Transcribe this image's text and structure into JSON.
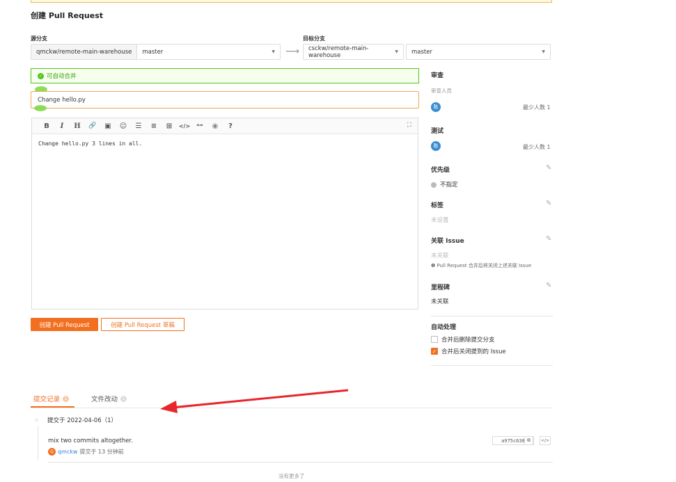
{
  "page": {
    "title": "创建 Pull Request"
  },
  "source": {
    "label": "源分支",
    "repo": "qmckw/remote-main-warehouse",
    "branch": "master"
  },
  "target": {
    "label": "目标分支",
    "repo": "csckw/remote-main-warehouse",
    "branch": "master"
  },
  "merge_status": "可自动合并",
  "pr": {
    "title": "Change hello.py",
    "body": "Change hello.py 3 lines in all."
  },
  "toolbar_icons": [
    "bold-icon",
    "italic-icon",
    "heading-icon",
    "link-icon",
    "image-icon",
    "emoji-icon",
    "unordered-list-icon",
    "ordered-list-icon",
    "table-icon",
    "code-icon",
    "quote-icon",
    "preview-icon",
    "help-icon"
  ],
  "toolbar_glyphs": {
    "bold": "B",
    "italic": "I",
    "heading": "H",
    "link": "🔗",
    "image": "▣",
    "emoji": "☺",
    "ul": "☰",
    "ol": "≡",
    "table": "⊞",
    "code": "</>",
    "quote": "❝❝",
    "preview": "◉",
    "help": "?"
  },
  "buttons": {
    "create": "创建 Pull Request",
    "create_draft": "创建 Pull Request 草稿"
  },
  "sidebar": {
    "review": {
      "title": "审查",
      "reviewers_label": "审查人员",
      "reviewer_avatar": "陈",
      "min_count": "最少人数 1"
    },
    "test": {
      "title": "测试",
      "tester_avatar": "陈",
      "min_count": "最少人数 1"
    },
    "priority": {
      "title": "优先级",
      "value": "不指定"
    },
    "labels": {
      "title": "标签",
      "value": "未设置"
    },
    "issue": {
      "title": "关联 Issue",
      "value": "未关联",
      "note": "Pull Request 合并后将关闭上述关联 Issue"
    },
    "milestone": {
      "title": "里程碑",
      "value": "未关联"
    },
    "auto": {
      "title": "自动处理",
      "opt_delete_branch": "合并后删除提交分支",
      "opt_delete_checked": false,
      "opt_close_issue": "合并后关闭提到的 Issue",
      "opt_close_checked": true
    }
  },
  "tabs": {
    "commits": "提交记录",
    "commits_badge": "1",
    "files": "文件改动",
    "files_badge": "1"
  },
  "commits": {
    "group": "提交于 2022-04-06（1）",
    "message": "mix two commits altogether.",
    "author_avatar": "Q",
    "author": "qmckw",
    "meta": "提交于 13 分钟前",
    "sha": "a975c638"
  },
  "footer": {
    "no_more": "没有更多了"
  },
  "colors": {
    "accent": "#f36f20",
    "success": "#52c41a",
    "avatar": "#3a8bd0",
    "annotation_arrow": "#e8262b"
  }
}
